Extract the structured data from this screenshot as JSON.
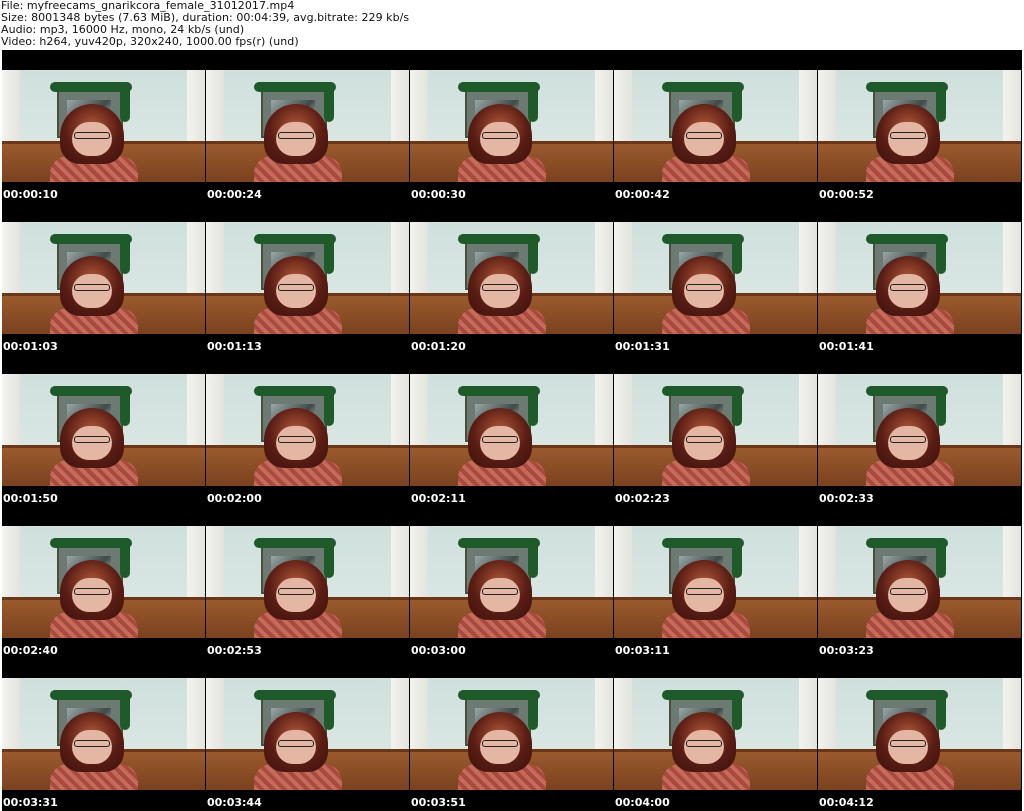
{
  "header": {
    "file_line": "File: myfreecams_gnarikcora_female_31012017.mp4",
    "size_line": "Size: 8001348 bytes (7.63 MiB), duration: 00:04:39, avg.bitrate: 229 kb/s",
    "audio_line": "Audio: mp3, 16000 Hz, mono, 24 kb/s (und)",
    "video_line": "Video: h264, yuv420p, 320x240, 1000.00 fps(r) (und)"
  },
  "thumbnails": [
    {
      "timestamp": "00:00:10"
    },
    {
      "timestamp": "00:00:24"
    },
    {
      "timestamp": "00:00:30"
    },
    {
      "timestamp": "00:00:42"
    },
    {
      "timestamp": "00:00:52"
    },
    {
      "timestamp": "00:01:03"
    },
    {
      "timestamp": "00:01:13"
    },
    {
      "timestamp": "00:01:20"
    },
    {
      "timestamp": "00:01:31"
    },
    {
      "timestamp": "00:01:41"
    },
    {
      "timestamp": "00:01:50"
    },
    {
      "timestamp": "00:02:00"
    },
    {
      "timestamp": "00:02:11"
    },
    {
      "timestamp": "00:02:23"
    },
    {
      "timestamp": "00:02:33"
    },
    {
      "timestamp": "00:02:40"
    },
    {
      "timestamp": "00:02:53"
    },
    {
      "timestamp": "00:03:00"
    },
    {
      "timestamp": "00:03:11"
    },
    {
      "timestamp": "00:03:23"
    },
    {
      "timestamp": "00:03:31"
    },
    {
      "timestamp": "00:03:44"
    },
    {
      "timestamp": "00:03:51"
    },
    {
      "timestamp": "00:04:00"
    },
    {
      "timestamp": "00:04:12"
    }
  ],
  "colors": {
    "sheet_background": "#000000",
    "timestamp_text": "#ffffff",
    "header_text": "#111111"
  }
}
